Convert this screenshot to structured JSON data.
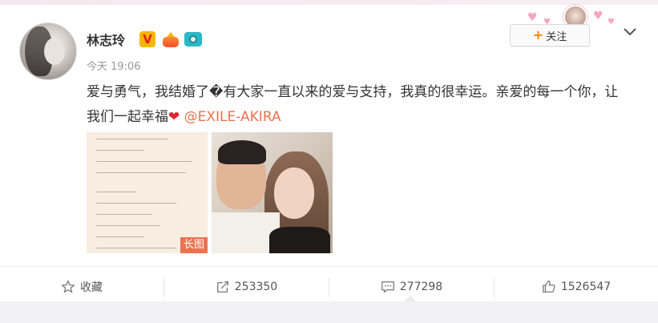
{
  "post": {
    "user_name": "林志玲",
    "time": "今天 19:06",
    "text": "爱与勇气，我结婚了�有大家一直以来的爱与支持，我真的很幸运。亲爱的每一个你，让我们一起幸福",
    "heart": "❤",
    "mention": "@EXILE-AKIRA",
    "badges": [
      "verified-v-badge",
      "crown-badge",
      "camera-badge"
    ],
    "images": [
      {
        "type": "handwritten-letter",
        "tag": "长图"
      },
      {
        "type": "couple-photo"
      }
    ]
  },
  "header": {
    "follow_plus": "+",
    "follow_label": "关注",
    "menu_icon": "chevron-down-icon"
  },
  "actions": {
    "favorite": {
      "icon": "star-icon",
      "label": "收藏"
    },
    "forward": {
      "icon": "share-icon",
      "count": "253350"
    },
    "comment": {
      "icon": "comment-icon",
      "count": "277298"
    },
    "like": {
      "icon": "thumbs-up-icon",
      "count": "1526547"
    }
  },
  "colors": {
    "accent": "#eb7350",
    "follow_plus": "#ff8200",
    "verified": "#f7b500",
    "text": "#333333",
    "muted": "#999999"
  }
}
